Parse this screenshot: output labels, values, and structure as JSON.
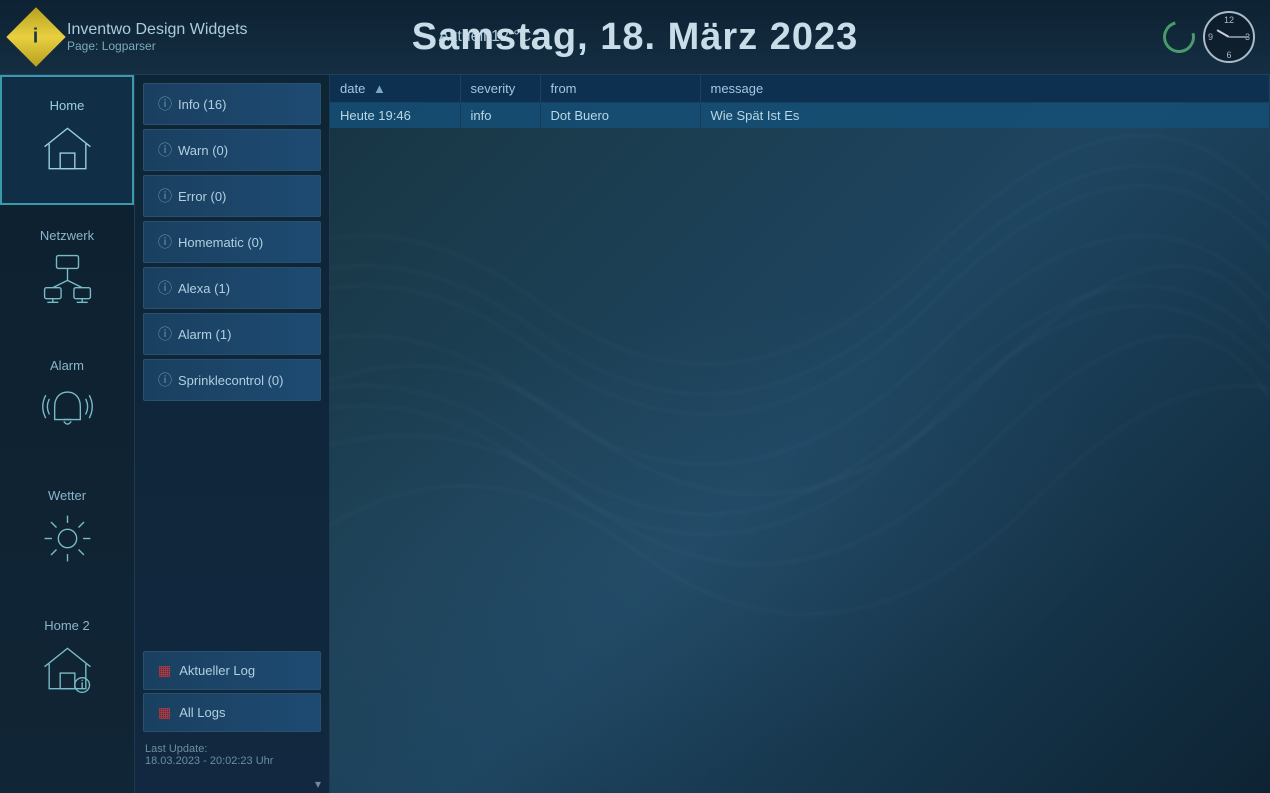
{
  "app": {
    "title": "Inventwo Design Widgets",
    "page": "Page: Logparser",
    "logo_letter": "i"
  },
  "header": {
    "temp": "Aktuell 12 °C",
    "date": "Samstag, 18. März 2023",
    "clock": {
      "hour_rotation": 300,
      "min_rotation": 90
    }
  },
  "sidebar": {
    "items": [
      {
        "id": "home",
        "label": "Home",
        "active": true
      },
      {
        "id": "netzwerk",
        "label": "Netzwerk",
        "active": false
      },
      {
        "id": "alarm",
        "label": "Alarm",
        "active": false
      },
      {
        "id": "wetter",
        "label": "Wetter",
        "active": false
      },
      {
        "id": "home2",
        "label": "Home 2",
        "active": false
      }
    ]
  },
  "filters": {
    "buttons": [
      {
        "id": "info",
        "label": "Info (16)"
      },
      {
        "id": "warn",
        "label": "Warn (0)"
      },
      {
        "id": "error",
        "label": "Error (0)"
      },
      {
        "id": "homematic",
        "label": "Homematic (0)"
      },
      {
        "id": "alexa",
        "label": "Alexa (1)"
      },
      {
        "id": "alarm",
        "label": "Alarm (1)"
      },
      {
        "id": "sprinkle",
        "label": "Sprinklecontrol (0)"
      }
    ],
    "actions": [
      {
        "id": "aktueller-log",
        "label": "Aktueller Log"
      },
      {
        "id": "all-logs",
        "label": "All Logs"
      }
    ]
  },
  "last_update": {
    "label": "Last Update:",
    "value": "18.03.2023 - 20:02:23 Uhr"
  },
  "log_table": {
    "columns": [
      {
        "id": "date",
        "label": "date",
        "sortable": true,
        "sort": "asc"
      },
      {
        "id": "severity",
        "label": "severity",
        "sortable": false
      },
      {
        "id": "from",
        "label": "from",
        "sortable": false
      },
      {
        "id": "message",
        "label": "message",
        "sortable": false
      }
    ],
    "rows": [
      {
        "date": "Heute 19:46",
        "severity": "info",
        "from": "Dot Buero",
        "message": "Wie Spät Ist Es",
        "selected": true
      }
    ]
  }
}
